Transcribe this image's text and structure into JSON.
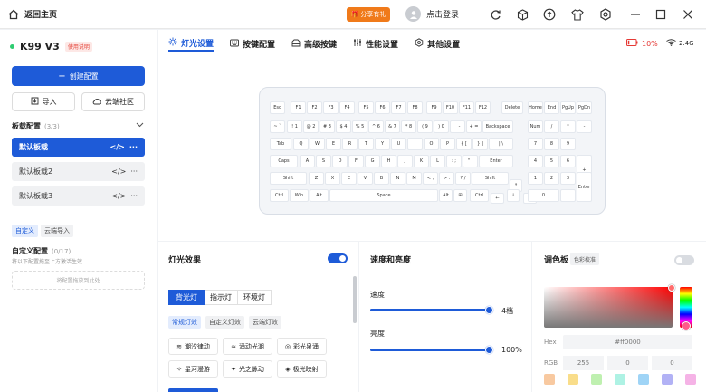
{
  "titlebar": {
    "back_label": "返回主页",
    "share_label": "分享有礼",
    "login_label": "点击登录"
  },
  "sidebar": {
    "device_name": "K99 V3",
    "manual_label": "使用说明",
    "create_config": "创建配置",
    "import": "导入",
    "cloud_community": "云端社区",
    "profile_section": "板载配置",
    "profile_count": "(3/3)",
    "profiles": [
      {
        "name": "默认板载"
      },
      {
        "name": "默认板载2"
      },
      {
        "name": "默认板载3"
      }
    ],
    "tab_custom": "自定义",
    "tab_cloud_import": "云端导入",
    "custom_section": "自定义配置",
    "custom_count": "(0/17)",
    "custom_hint": "将以下配置拖至上方激活生效",
    "drop_hint": "将配置拖放到此处"
  },
  "nav_tabs": [
    {
      "label": "灯光设置"
    },
    {
      "label": "按键配置"
    },
    {
      "label": "高级按键"
    },
    {
      "label": "性能设置"
    },
    {
      "label": "其他设置"
    }
  ],
  "status": {
    "battery": "10%",
    "connection": "2.4G",
    "battery_color": "#e53935"
  },
  "keyboard": {
    "row0": [
      "Esc",
      "F1",
      "F2",
      "F3",
      "F4",
      "F5",
      "F6",
      "F7",
      "F8",
      "F9",
      "F10",
      "F11",
      "F12",
      "Delete",
      "Home",
      "End",
      "PgUp",
      "PgDn"
    ],
    "row1": [
      "~ `",
      "! 1",
      "@ 2",
      "# 3",
      "$ 4",
      "% 5",
      "^ 6",
      "& 7",
      "* 8",
      "( 9",
      ") 0",
      "_ -",
      "+ =",
      "Backspace",
      "Num",
      "/",
      "*",
      "-"
    ],
    "row2": [
      "Tab",
      "Q",
      "W",
      "E",
      "R",
      "T",
      "Y",
      "U",
      "I",
      "O",
      "P",
      "{ [",
      "} ]",
      "| \\",
      "7",
      "8",
      "9"
    ],
    "row3": [
      "Caps",
      "A",
      "S",
      "D",
      "F",
      "G",
      "H",
      "J",
      "K",
      "L",
      ": ;",
      "\" '",
      "Enter",
      "4",
      "5",
      "6",
      "+"
    ],
    "row4": [
      "Shift",
      "Z",
      "X",
      "C",
      "V",
      "B",
      "N",
      "M",
      "< ,",
      "> .",
      "? /",
      "Shift",
      "↑",
      "1",
      "2",
      "3"
    ],
    "row5": [
      "Ctrl",
      "Win",
      "Alt",
      "Space",
      "Alt",
      "⊞",
      "Ctrl",
      "←",
      "↓",
      "→",
      "0",
      ".",
      "Enter"
    ]
  },
  "lighting": {
    "title": "灯光效果",
    "subtabs": [
      "背光灯",
      "指示灯",
      "环境灯"
    ],
    "chips": [
      "常规灯效",
      "自定义灯效",
      "云端灯效"
    ],
    "effects": [
      {
        "label": "潮汐律动",
        "icon": "tide-icon"
      },
      {
        "label": "涌动光潮",
        "icon": "wave-icon"
      },
      {
        "label": "彩光泉涌",
        "icon": "spring-icon"
      },
      {
        "label": "星河漫游",
        "icon": "star-icon"
      },
      {
        "label": "光之脉动",
        "icon": "pulse-icon"
      },
      {
        "label": "极光映射",
        "icon": "aurora-icon"
      }
    ]
  },
  "speed_brightness": {
    "title": "速度和亮度",
    "speed_label": "速度",
    "speed_value": "4档",
    "speed_level": 1.0,
    "brightness_label": "亮度",
    "brightness_value": "100%",
    "brightness_level": 1.0
  },
  "palette": {
    "title": "调色板",
    "calibrate_label": "色彩校准",
    "hex_label": "Hex",
    "hex_value": "#ff0000",
    "rgb_label": "RGB",
    "rgb_values": [
      "255",
      "0",
      "0"
    ],
    "swatches": [
      "#f8c9a0",
      "#f9dd8a",
      "#bff0b0",
      "#aef2e4",
      "#9fd4f6",
      "#b2b2f5",
      "#f5b3e6"
    ],
    "accent": "#1e5bd8"
  }
}
